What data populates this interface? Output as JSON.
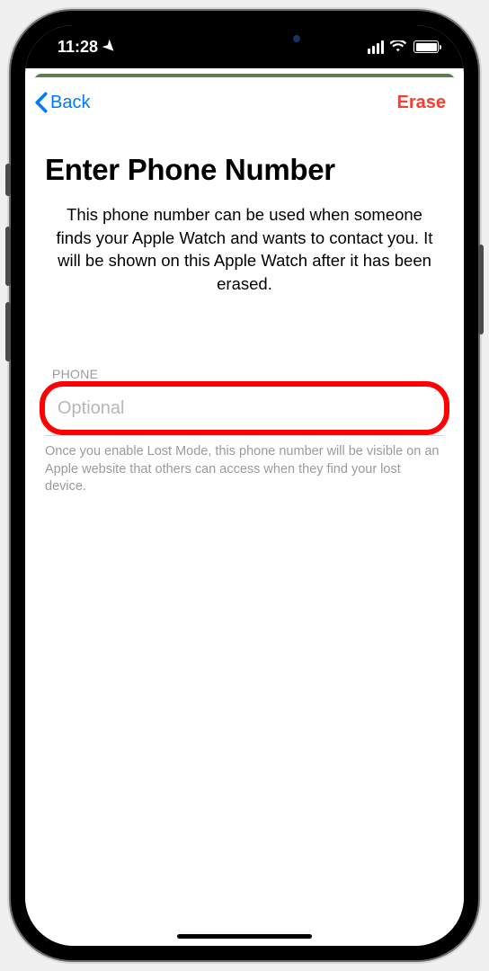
{
  "status": {
    "time": "11:28",
    "location_icon": "location-arrow"
  },
  "nav": {
    "back_label": "Back",
    "action_label": "Erase"
  },
  "page": {
    "title": "Enter Phone Number",
    "description": "This phone number can be used when someone finds your Apple Watch and wants to contact you. It will be shown on this Apple Watch after it has been erased."
  },
  "form": {
    "phone_label": "PHONE",
    "phone_placeholder": "Optional",
    "phone_value": "",
    "footnote": "Once you enable Lost Mode, this phone number will be visible on an Apple website that others can access when they find your lost device."
  },
  "annotation": {
    "highlight_color": "#ff0004"
  }
}
